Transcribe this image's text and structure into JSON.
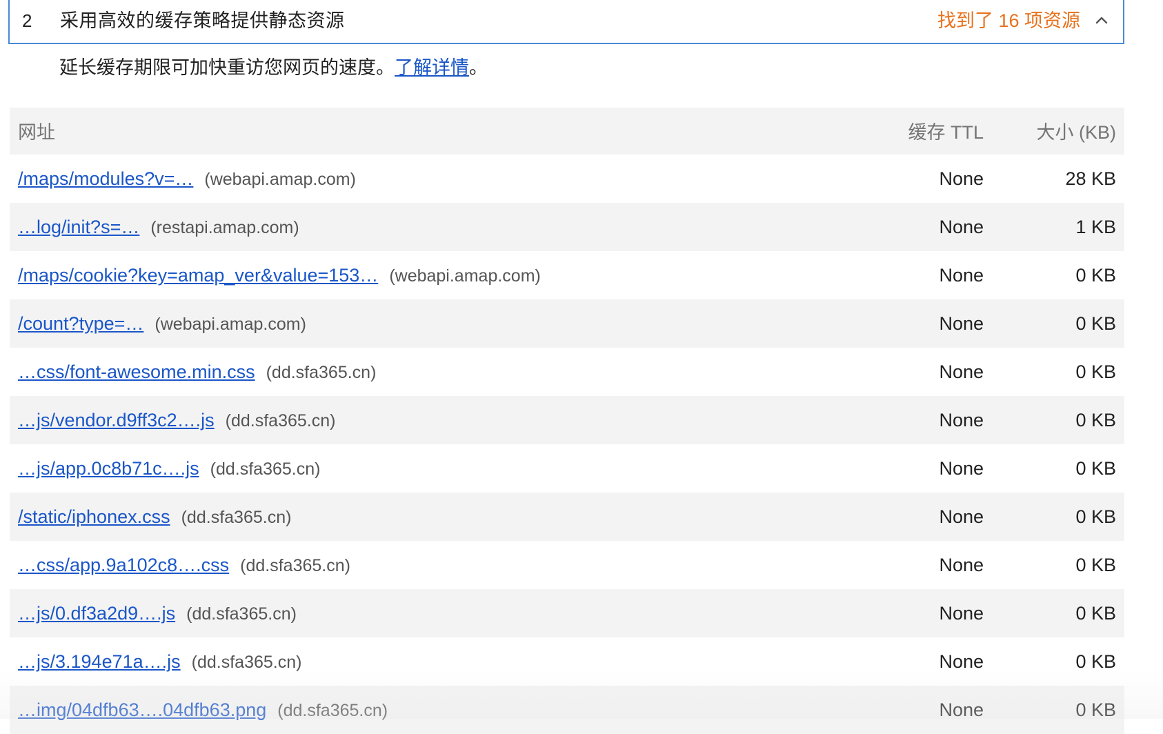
{
  "audit": {
    "index": "2",
    "title": "采用高效的缓存策略提供静态资源",
    "display_value": "找到了 16 项资源",
    "description_prefix": "延长缓存期限可加快重访您网页的速度。",
    "learn_more": "了解详情",
    "description_suffix": "。"
  },
  "table": {
    "headers": {
      "url": "网址",
      "cache_ttl": "缓存 TTL",
      "size": "大小 (KB)"
    },
    "rows": [
      {
        "url": "/maps/modules?v=…",
        "host": "(webapi.amap.com)",
        "ttl": "None",
        "size": "28 KB"
      },
      {
        "url": "…log/init?s=…",
        "host": "(restapi.amap.com)",
        "ttl": "None",
        "size": "1 KB"
      },
      {
        "url": "/maps/cookie?key=amap_ver&value=153…",
        "host": "(webapi.amap.com)",
        "ttl": "None",
        "size": "0 KB"
      },
      {
        "url": "/count?type=…",
        "host": "(webapi.amap.com)",
        "ttl": "None",
        "size": "0 KB"
      },
      {
        "url": "…css/font-awesome.min.css",
        "host": "(dd.sfa365.cn)",
        "ttl": "None",
        "size": "0 KB"
      },
      {
        "url": "…js/vendor.d9ff3c2….js",
        "host": "(dd.sfa365.cn)",
        "ttl": "None",
        "size": "0 KB"
      },
      {
        "url": "…js/app.0c8b71c….js",
        "host": "(dd.sfa365.cn)",
        "ttl": "None",
        "size": "0 KB"
      },
      {
        "url": "/static/iphonex.css",
        "host": "(dd.sfa365.cn)",
        "ttl": "None",
        "size": "0 KB"
      },
      {
        "url": "…css/app.9a102c8….css",
        "host": "(dd.sfa365.cn)",
        "ttl": "None",
        "size": "0 KB"
      },
      {
        "url": "…js/0.df3a2d9….js",
        "host": "(dd.sfa365.cn)",
        "ttl": "None",
        "size": "0 KB"
      },
      {
        "url": "…js/3.194e71a….js",
        "host": "(dd.sfa365.cn)",
        "ttl": "None",
        "size": "0 KB"
      },
      {
        "url": "…img/04dfb63….04dfb63.png",
        "host": "(dd.sfa365.cn)",
        "ttl": "None",
        "size": "0 KB"
      }
    ]
  },
  "colors": {
    "accent_border": "#4a8ad8",
    "warning_text": "#e8711b",
    "link": "#1a56c8",
    "stripe": "#f3f3f3"
  },
  "icons": {
    "collapse": "chevron-up-icon"
  }
}
